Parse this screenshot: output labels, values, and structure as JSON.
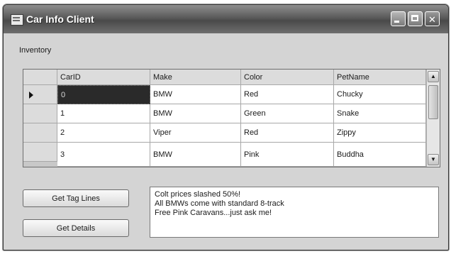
{
  "window": {
    "title": "Car Info Client",
    "controls": {
      "minimize": "_",
      "close": "✕"
    }
  },
  "inventory_label": "Inventory",
  "grid": {
    "columns": [
      "CarID",
      "Make",
      "Color",
      "PetName"
    ],
    "rows": [
      {
        "carid": "0",
        "make": "BMW",
        "color": "Red",
        "petname": "Chucky"
      },
      {
        "carid": "1",
        "make": "BMW",
        "color": "Green",
        "petname": "Snake"
      },
      {
        "carid": "2",
        "make": "Viper",
        "color": "Red",
        "petname": "Zippy"
      },
      {
        "carid": "3",
        "make": "BMW",
        "color": "Pink",
        "petname": "Buddha"
      }
    ],
    "current_row_marker": "►",
    "scroll": {
      "up": "▲",
      "down": "▼"
    }
  },
  "buttons": {
    "get_tag_lines": "Get Tag Lines",
    "get_details": "Get Details"
  },
  "output_text": "Colt prices slashed 50%!\nAll BMWs come with standard 8-track\nFree Pink Caravans...just ask me!"
}
